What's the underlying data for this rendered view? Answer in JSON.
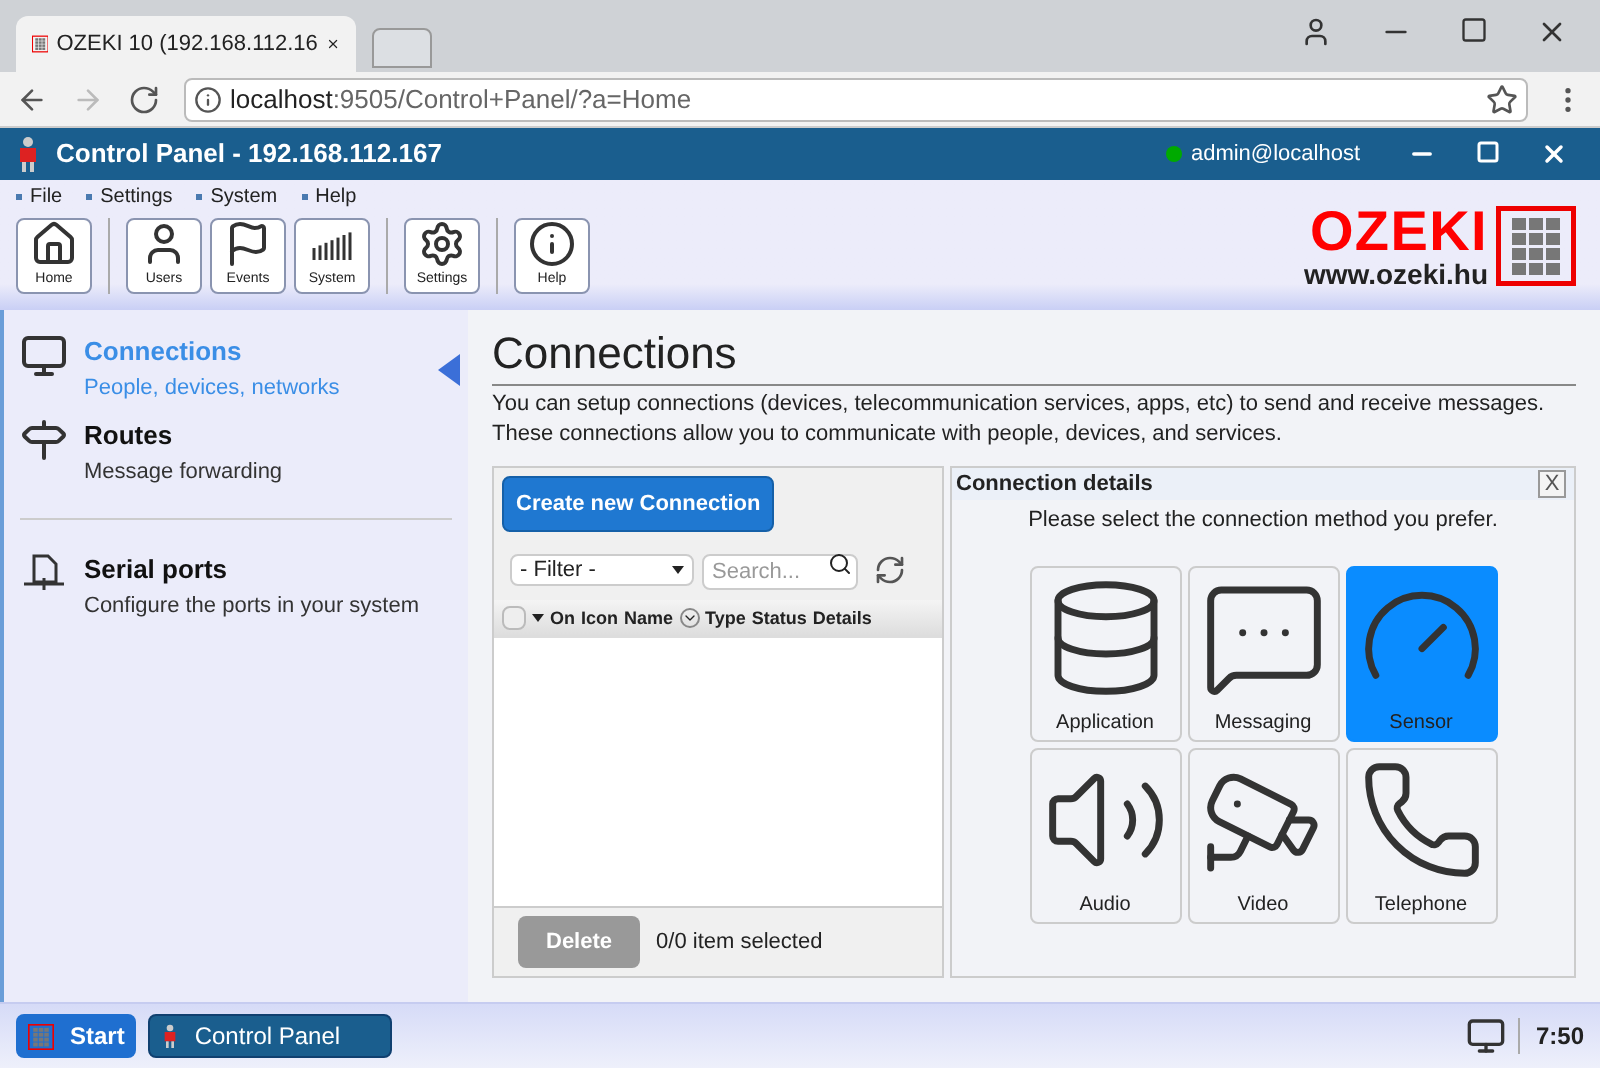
{
  "browser": {
    "tab_title": "OZEKI 10 (192.168.112.16",
    "url_host": "localhost",
    "url_rest": ":9505/Control+Panel/?a=Home"
  },
  "app_bar": {
    "title": "Control Panel - 192.168.112.167",
    "user": "admin@localhost"
  },
  "menu": [
    "File",
    "Settings",
    "System",
    "Help"
  ],
  "toolbar": {
    "groups": [
      {
        "buttons": [
          {
            "label": "Home",
            "kind": "home"
          }
        ]
      },
      {
        "buttons": [
          {
            "label": "Users",
            "kind": "users"
          },
          {
            "label": "Events",
            "kind": "events"
          },
          {
            "label": "System",
            "kind": "system"
          }
        ]
      },
      {
        "buttons": [
          {
            "label": "Settings",
            "kind": "settings"
          }
        ]
      },
      {
        "buttons": [
          {
            "label": "Help",
            "kind": "help"
          }
        ]
      }
    ]
  },
  "logo": {
    "name": "OZEKI",
    "url": "www.ozeki.hu"
  },
  "sidebar": {
    "items": [
      {
        "title": "Connections",
        "subtitle": "People, devices, networks",
        "kind": "connections",
        "selected": true
      },
      {
        "title": "Routes",
        "subtitle": "Message forwarding",
        "kind": "routes",
        "selected": false
      },
      {
        "title": "Serial ports",
        "subtitle": "Configure the ports in your system",
        "kind": "serial",
        "selected": false
      }
    ]
  },
  "page": {
    "title": "Connections",
    "description": "You can setup connections (devices, telecommunication services, apps, etc) to send and receive messages. These connections allow you to communicate with people, devices, and services."
  },
  "list_panel": {
    "create_button": "Create new Connection",
    "filter": "- Filter -",
    "select_all_checked": false,
    "search_placeholder": "Search...",
    "columns": [
      "On",
      "Icon",
      "Name",
      "Type",
      "Status",
      "Details"
    ],
    "delete_button": "Delete",
    "selection_status": "0/0 item selected"
  },
  "details": {
    "title": "Connection details",
    "prompt": "Please select the connection method you prefer.",
    "close": "X",
    "methods": [
      {
        "label": "Application",
        "kind": "application",
        "selected": false
      },
      {
        "label": "Messaging",
        "kind": "messaging",
        "selected": false
      },
      {
        "label": "Sensor",
        "kind": "sensor",
        "selected": true
      },
      {
        "label": "Audio",
        "kind": "audio",
        "selected": false
      },
      {
        "label": "Video",
        "kind": "video",
        "selected": false
      },
      {
        "label": "Telephone",
        "kind": "telephone",
        "selected": false
      }
    ]
  },
  "taskbar": {
    "start": "Start",
    "window": "Control Panel",
    "clock": "7:50"
  }
}
